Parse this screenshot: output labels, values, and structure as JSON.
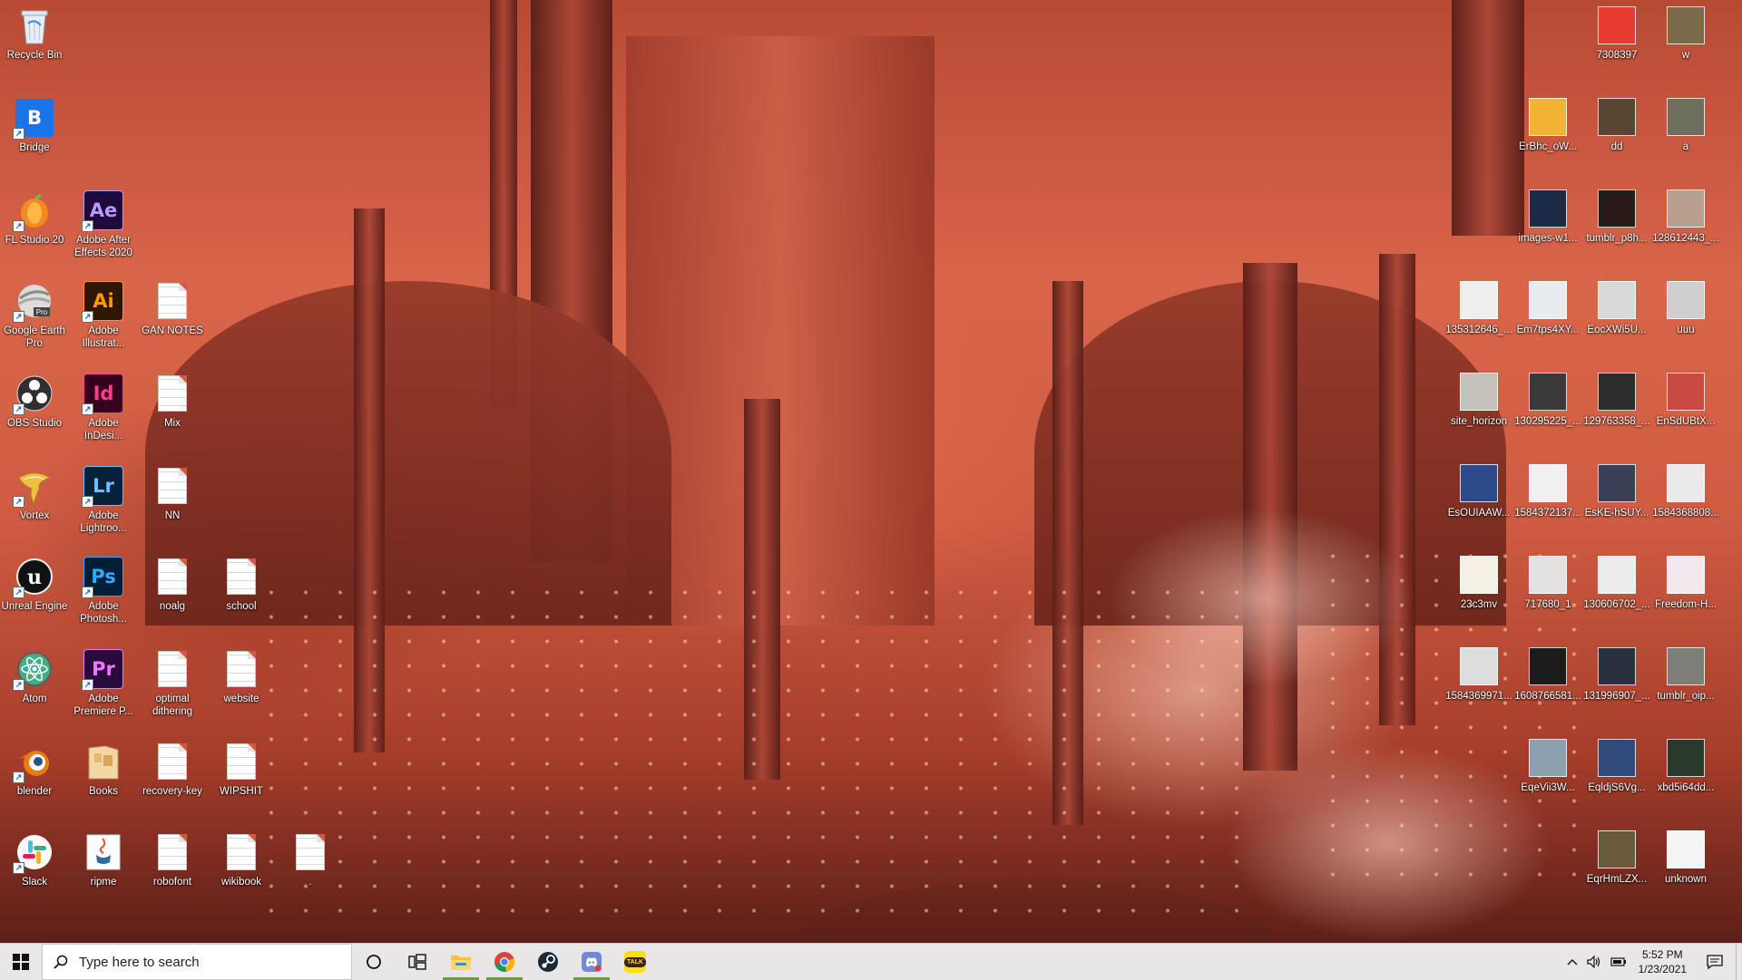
{
  "desktop": {
    "icons_left": [
      {
        "id": "recycle-bin",
        "label": "Recycle Bin",
        "icon": "recycle-bin-icon"
      },
      {
        "id": "bridge",
        "label": "Bridge",
        "icon": "bridge-icon",
        "letter": "B",
        "color": "#1b73e8"
      },
      {
        "id": "fl-studio",
        "label": "FL Studio 20",
        "icon": "fl-studio-icon"
      },
      {
        "id": "after-effects",
        "label": "Adobe After Effects 2020",
        "icon": "after-effects-icon",
        "letter": "Ae",
        "bg": "#1f0a3a",
        "fg": "#b49cff"
      },
      {
        "id": "google-earth",
        "label": "Google Earth Pro",
        "icon": "google-earth-icon"
      },
      {
        "id": "illustrator",
        "label": "Adobe Illustrat...",
        "icon": "illustrator-icon",
        "letter": "Ai",
        "bg": "#2f1600",
        "fg": "#ff9a00"
      },
      {
        "id": "gan-notes",
        "label": "GAN NOTES",
        "icon": "text-file-icon"
      },
      {
        "id": "obs",
        "label": "OBS Studio",
        "icon": "obs-icon"
      },
      {
        "id": "indesign",
        "label": "Adobe InDesi...",
        "icon": "indesign-icon",
        "letter": "Id",
        "bg": "#35001b",
        "fg": "#ff3f8d"
      },
      {
        "id": "mix",
        "label": "Mix",
        "icon": "text-file-icon"
      },
      {
        "id": "vortex",
        "label": "Vortex",
        "icon": "vortex-icon"
      },
      {
        "id": "lightroom",
        "label": "Adobe Lightroo...",
        "icon": "lightroom-icon",
        "letter": "Lr",
        "bg": "#07213a",
        "fg": "#67c3ff"
      },
      {
        "id": "nn",
        "label": "NN",
        "icon": "text-file-icon"
      },
      {
        "id": "unreal",
        "label": "Unreal Engine",
        "icon": "unreal-engine-icon"
      },
      {
        "id": "photoshop",
        "label": "Adobe Photosh...",
        "icon": "photoshop-icon",
        "letter": "Ps",
        "bg": "#001e36",
        "fg": "#31a8ff"
      },
      {
        "id": "noalg",
        "label": "noalg",
        "icon": "text-file-icon"
      },
      {
        "id": "school",
        "label": "school",
        "icon": "text-file-icon"
      },
      {
        "id": "atom",
        "label": "Atom",
        "icon": "atom-icon"
      },
      {
        "id": "premiere",
        "label": "Adobe Premiere P...",
        "icon": "premiere-icon",
        "letter": "Pr",
        "bg": "#2a0a3a",
        "fg": "#ea77ff"
      },
      {
        "id": "optimal-dithering",
        "label": "optimal dithering",
        "icon": "text-file-icon"
      },
      {
        "id": "website",
        "label": "website",
        "icon": "text-file-icon"
      },
      {
        "id": "blender",
        "label": "blender",
        "icon": "blender-icon"
      },
      {
        "id": "books",
        "label": "Books",
        "icon": "books-icon"
      },
      {
        "id": "recovery-key",
        "label": "recovery-key",
        "icon": "text-file-icon"
      },
      {
        "id": "wipshit",
        "label": "WIPSHIT",
        "icon": "text-file-icon"
      },
      {
        "id": "slack",
        "label": "Slack",
        "icon": "slack-icon"
      },
      {
        "id": "ripme",
        "label": "ripme",
        "icon": "java-icon"
      },
      {
        "id": "robofont",
        "label": "robofont",
        "icon": "text-file-icon"
      },
      {
        "id": "wikibook",
        "label": "wikibook",
        "icon": "text-file-icon"
      },
      {
        "id": "dot-file",
        "label": ".",
        "icon": "text-file-icon"
      }
    ],
    "icons_right": [
      {
        "id": "img-7308397",
        "label": "7308397",
        "color": "#e63b2e"
      },
      {
        "id": "img-w",
        "label": "w",
        "color": "#7a6a4a"
      },
      {
        "id": "img-erbhc",
        "label": "ErBhc_oW...",
        "color": "#f2b233"
      },
      {
        "id": "img-dd",
        "label": "dd",
        "color": "#5a4630"
      },
      {
        "id": "img-a",
        "label": "a",
        "color": "#6e6e5c"
      },
      {
        "id": "img-images-w1",
        "label": "images-w1...",
        "color": "#1d2a45"
      },
      {
        "id": "img-tumblr-p8h",
        "label": "tumblr_p8h...",
        "color": "#2a1a1a"
      },
      {
        "id": "img-128612443",
        "label": "128612443_...",
        "color": "#b8a090"
      },
      {
        "id": "img-135312646",
        "label": "135312646_...",
        "color": "#eeeeee"
      },
      {
        "id": "img-em7tps4xy",
        "label": "Em7tps4XY...",
        "color": "#e8ecf0"
      },
      {
        "id": "img-eocxwi5u",
        "label": "EocXWi5U...",
        "color": "#d9d9d9"
      },
      {
        "id": "img-uuu",
        "label": "uuu",
        "color": "#cfcfcf"
      },
      {
        "id": "img-site-horizon",
        "label": "site_horizon",
        "color": "#c5c0b8"
      },
      {
        "id": "img-130295225",
        "label": "130295225_...",
        "color": "#3a3a3a"
      },
      {
        "id": "img-129763358",
        "label": "129763358_...",
        "color": "#2d2d2d"
      },
      {
        "id": "img-ensdubtx",
        "label": "EnSdUBtX...",
        "color": "#c94a44"
      },
      {
        "id": "img-esouiaaw",
        "label": "EsOUIAAW...",
        "color": "#2d4a8a"
      },
      {
        "id": "img-1584372137",
        "label": "1584372137...",
        "color": "#f0f0f0"
      },
      {
        "id": "img-eske-hsuy",
        "label": "EsKE-hSUY...",
        "color": "#3a3f55"
      },
      {
        "id": "img-1584368808",
        "label": "1584368808...",
        "color": "#eaeaea"
      },
      {
        "id": "img-23c3mv",
        "label": "23c3mv",
        "color": "#f4f0e6"
      },
      {
        "id": "img-717680-1",
        "label": "717680_1",
        "color": "#e2e2e2"
      },
      {
        "id": "img-130606702",
        "label": "130606702_...",
        "color": "#ececec"
      },
      {
        "id": "img-freedom-h",
        "label": "Freedom-H...",
        "color": "#f2e9ee"
      },
      {
        "id": "img-1584369971",
        "label": "1584369971...",
        "color": "#dddddd"
      },
      {
        "id": "img-1608766581",
        "label": "1608766581...",
        "color": "#1c1c1c"
      },
      {
        "id": "img-131996907",
        "label": "131996907_...",
        "color": "#2b3040"
      },
      {
        "id": "img-tumblr-oip",
        "label": "tumblr_oip...",
        "color": "#7e7e78"
      },
      {
        "id": "img-eqevii3w",
        "label": "EqeVii3W...",
        "color": "#8ca0b0"
      },
      {
        "id": "img-eqldjs6vg",
        "label": "EqldjS6Vg...",
        "color": "#304a7a"
      },
      {
        "id": "img-xbd5i64dd",
        "label": "xbd5i64dd...",
        "color": "#2a3a2a"
      },
      {
        "id": "img-eqrhmlzx",
        "label": "EqrHmLZX...",
        "color": "#6a5a3a"
      },
      {
        "id": "img-unknown",
        "label": "unknown",
        "color": "#f4f4f4"
      }
    ]
  },
  "taskbar": {
    "search_placeholder": "Type here to search",
    "clock_time": "5:52 PM",
    "clock_date": "1/23/2021",
    "pinned": [
      {
        "id": "file-explorer",
        "icon": "folder-icon",
        "active": true
      },
      {
        "id": "chrome",
        "icon": "chrome-icon",
        "active": true
      },
      {
        "id": "steam",
        "icon": "steam-icon",
        "active": false
      },
      {
        "id": "discord",
        "icon": "discord-icon",
        "active": true
      },
      {
        "id": "kakaotalk",
        "icon": "kakaotalk-icon",
        "active": false,
        "text": "TALK"
      }
    ]
  },
  "colors": {
    "taskbar_bg": "#e8e6e7",
    "active_indicator": "#6b9e3f",
    "wallpaper_accent": "#d9654a"
  }
}
